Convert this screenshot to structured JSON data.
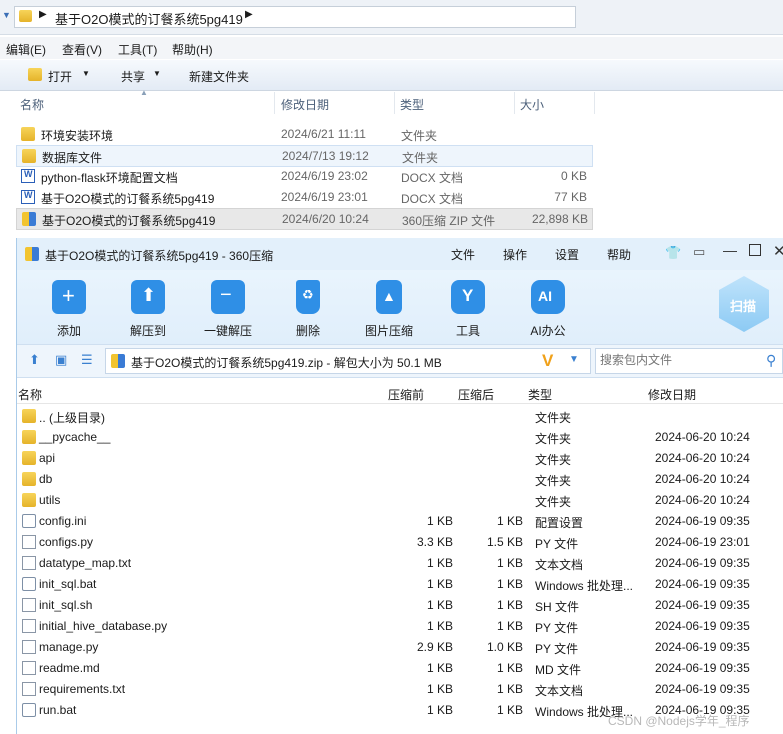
{
  "explorer": {
    "breadcrumb": "基于O2O模式的订餐系统5pg419",
    "menu": [
      "编辑(E)",
      "查看(V)",
      "工具(T)",
      "帮助(H)"
    ],
    "toolbar": {
      "open": "打开",
      "share": "共享",
      "new_folder": "新建文件夹"
    },
    "columns": {
      "name": "名称",
      "modified": "修改日期",
      "type": "类型",
      "size": "大小"
    },
    "rows": [
      {
        "name": "环境安装环境",
        "modified": "2024/6/21 11:11",
        "type": "文件夹",
        "size": "",
        "icon": "folder-icon"
      },
      {
        "name": "数据库文件",
        "modified": "2024/7/13 19:12",
        "type": "文件夹",
        "size": "",
        "icon": "folder-icon"
      },
      {
        "name": "python-flask环境配置文档",
        "modified": "2024/6/19 23:02",
        "type": "DOCX 文档",
        "size": "0 KB",
        "icon": "word-icon"
      },
      {
        "name": "基于O2O模式的订餐系统5pg419",
        "modified": "2024/6/19 23:01",
        "type": "DOCX 文档",
        "size": "77 KB",
        "icon": "word-icon"
      },
      {
        "name": "基于O2O模式的订餐系统5pg419",
        "modified": "2024/6/20 10:24",
        "type": "360压缩 ZIP 文件",
        "size": "22,898 KB",
        "icon": "zip-icon"
      }
    ]
  },
  "zip": {
    "title": "基于O2O模式的订餐系统5pg419 - 360压缩",
    "menu": [
      "文件",
      "操作",
      "设置",
      "帮助"
    ],
    "tools": [
      {
        "label": "添加",
        "icon": "add-icon",
        "color": "#2f8fe6"
      },
      {
        "label": "解压到",
        "icon": "extract-to-icon",
        "color": "#2f8fe6"
      },
      {
        "label": "一键解压",
        "icon": "one-click-extract-icon",
        "color": "#2f8fe6"
      },
      {
        "label": "删除",
        "icon": "delete-icon",
        "color": "#2f8fe6"
      },
      {
        "label": "图片压缩",
        "icon": "image-compress-icon",
        "color": "#2f8fe6"
      },
      {
        "label": "工具",
        "icon": "tools-icon",
        "color": "#2f8fe6"
      },
      {
        "label": "AI办公",
        "icon": "ai-office-icon",
        "color": "#2f8fe6"
      }
    ],
    "scan_label": "扫描",
    "path_text": "基于O2O模式的订餐系统5pg419.zip - 解包大小为 50.1 MB",
    "search_placeholder": "搜索包内文件",
    "columns": {
      "name": "名称",
      "before": "压缩前",
      "after": "压缩后",
      "type": "类型",
      "modified": "修改日期"
    },
    "rows": [
      {
        "name": ".. (上级目录)",
        "before": "",
        "after": "",
        "type": "文件夹",
        "modified": "",
        "icon": "folder"
      },
      {
        "name": "__pycache__",
        "before": "",
        "after": "",
        "type": "文件夹",
        "modified": "2024-06-20 10:24",
        "icon": "folder"
      },
      {
        "name": "api",
        "before": "",
        "after": "",
        "type": "文件夹",
        "modified": "2024-06-20 10:24",
        "icon": "folder"
      },
      {
        "name": "db",
        "before": "",
        "after": "",
        "type": "文件夹",
        "modified": "2024-06-20 10:24",
        "icon": "folder"
      },
      {
        "name": "utils",
        "before": "",
        "after": "",
        "type": "文件夹",
        "modified": "2024-06-20 10:24",
        "icon": "folder"
      },
      {
        "name": "config.ini",
        "before": "1 KB",
        "after": "1 KB",
        "type": "配置设置",
        "modified": "2024-06-19 09:35",
        "icon": "gear"
      },
      {
        "name": "configs.py",
        "before": "3.3 KB",
        "after": "1.5 KB",
        "type": "PY 文件",
        "modified": "2024-06-19 23:01",
        "icon": "doc"
      },
      {
        "name": "datatype_map.txt",
        "before": "1 KB",
        "after": "1 KB",
        "type": "文本文档",
        "modified": "2024-06-19 09:35",
        "icon": "doc"
      },
      {
        "name": "init_sql.bat",
        "before": "1 KB",
        "after": "1 KB",
        "type": "Windows 批处理...",
        "modified": "2024-06-19 09:35",
        "icon": "gear"
      },
      {
        "name": "init_sql.sh",
        "before": "1 KB",
        "after": "1 KB",
        "type": "SH 文件",
        "modified": "2024-06-19 09:35",
        "icon": "doc"
      },
      {
        "name": "initial_hive_database.py",
        "before": "1 KB",
        "after": "1 KB",
        "type": "PY 文件",
        "modified": "2024-06-19 09:35",
        "icon": "doc"
      },
      {
        "name": "manage.py",
        "before": "2.9 KB",
        "after": "1.0 KB",
        "type": "PY 文件",
        "modified": "2024-06-19 09:35",
        "icon": "doc"
      },
      {
        "name": "readme.md",
        "before": "1 KB",
        "after": "1 KB",
        "type": "MD 文件",
        "modified": "2024-06-19 09:35",
        "icon": "doc"
      },
      {
        "name": "requirements.txt",
        "before": "1 KB",
        "after": "1 KB",
        "type": "文本文档",
        "modified": "2024-06-19 09:35",
        "icon": "doc"
      },
      {
        "name": "run.bat",
        "before": "1 KB",
        "after": "1 KB",
        "type": "Windows 批处理...",
        "modified": "2024-06-19 09:35",
        "icon": "gear"
      }
    ]
  },
  "watermark": "CSDN @Nodejs学年_程序"
}
